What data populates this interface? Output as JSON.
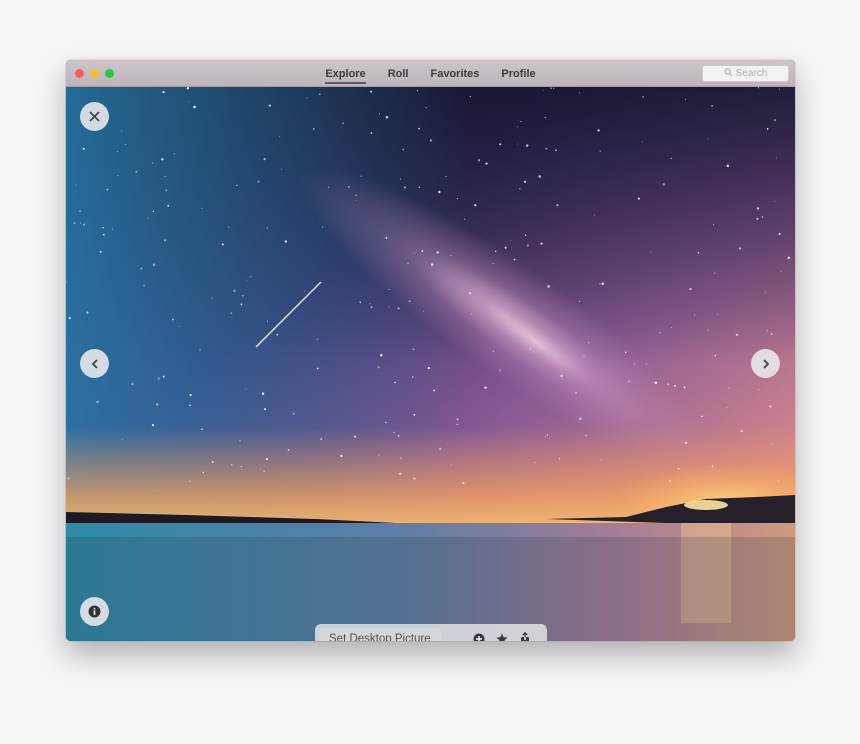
{
  "window": {
    "traffic_lights": [
      "close",
      "minimize",
      "maximize"
    ]
  },
  "nav": {
    "tabs": [
      {
        "label": "Explore",
        "active": true
      },
      {
        "label": "Roll",
        "active": false
      },
      {
        "label": "Favorites",
        "active": false
      },
      {
        "label": "Profile",
        "active": false
      }
    ]
  },
  "search": {
    "placeholder": "Search",
    "icon": "search-icon"
  },
  "viewer": {
    "close_icon": "close-icon",
    "prev_icon": "chevron-left-icon",
    "next_icon": "chevron-right-icon",
    "info_icon": "info-icon"
  },
  "toolbar": {
    "set_desktop_label": "Set Desktop Picture",
    "icons": [
      "add-circle-icon",
      "star-icon",
      "share-icon"
    ]
  },
  "colors": {
    "titlebar": "#c4bcc3",
    "accent_tab": "#5a5a5e",
    "close": "#fc5f57",
    "minimize": "#fdbc2e",
    "maximize": "#2ac940"
  }
}
